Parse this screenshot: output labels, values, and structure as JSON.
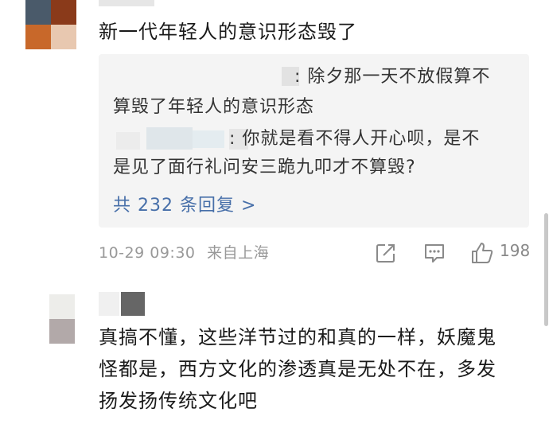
{
  "comment1": {
    "text": "新一代年轻人的意识形态毁了",
    "replies": [
      {
        "username_visible": ":",
        "line1": "除夕那一天不放假算不",
        "line2": "算毁了年轻人的意识形态"
      },
      {
        "username_visible": ":",
        "line1": "你就是看不得人开心呗，是不",
        "line2": "是见了面行礼问安三跪九叩才不算毁?"
      }
    ],
    "reply_count_label": "共 232 条回复 >",
    "timestamp": "10-29 09:30",
    "source": "来自上海",
    "like_count": "198"
  },
  "comment2": {
    "line1": "真搞不懂，这些洋节过的和真的一样，妖魔鬼",
    "line2": "怪都是，西方文化的渗透真是无处不在，多发",
    "line3": "扬发扬传统文化吧"
  },
  "colors": {
    "link_blue": "#476fa9",
    "reply_bg": "#f4f4f4",
    "meta_gray": "#999999",
    "text": "#1a1a1a"
  },
  "icons": [
    "share-icon",
    "comment-icon",
    "like-icon"
  ]
}
